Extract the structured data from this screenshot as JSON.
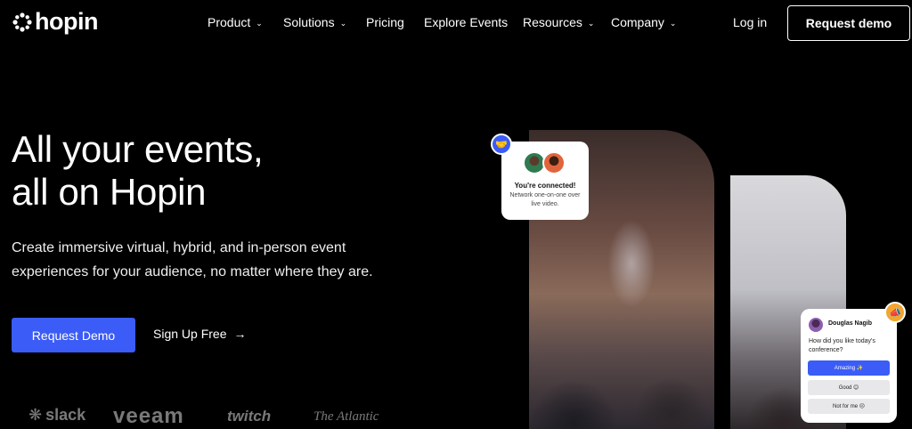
{
  "brand": {
    "name": "hopin",
    "icon": "hopin-logo-icon"
  },
  "nav": {
    "items": [
      {
        "label": "Product",
        "dropdown": true
      },
      {
        "label": "Solutions",
        "dropdown": true
      },
      {
        "label": "Pricing",
        "dropdown": false
      },
      {
        "label": "Explore Events",
        "dropdown": false
      },
      {
        "label": "Resources",
        "dropdown": true
      },
      {
        "label": "Company",
        "dropdown": true
      }
    ],
    "login": "Log in",
    "request_demo": "Request demo"
  },
  "hero": {
    "headline_line1": "All your events,",
    "headline_line2": "all on Hopin",
    "subtext": "Create immersive virtual, hybrid, and in-person event experiences for your audience, no matter where they are.",
    "cta_primary": "Request Demo",
    "cta_secondary": "Sign Up Free"
  },
  "customer_logos": [
    "slack",
    "veeam",
    "twitch",
    "The Atlantic"
  ],
  "connect_card": {
    "title": "You're connected!",
    "subtitle": "Network one-on-one over live video."
  },
  "poll_card": {
    "name": "Douglas Nagib",
    "question": "How did you like today's conference?",
    "options": [
      "Amazing ✨",
      "Good 😊",
      "Not for me 😔"
    ]
  },
  "colors": {
    "accent": "#3b5cf6",
    "background": "#000000",
    "badge_orange": "#f2a52f"
  }
}
